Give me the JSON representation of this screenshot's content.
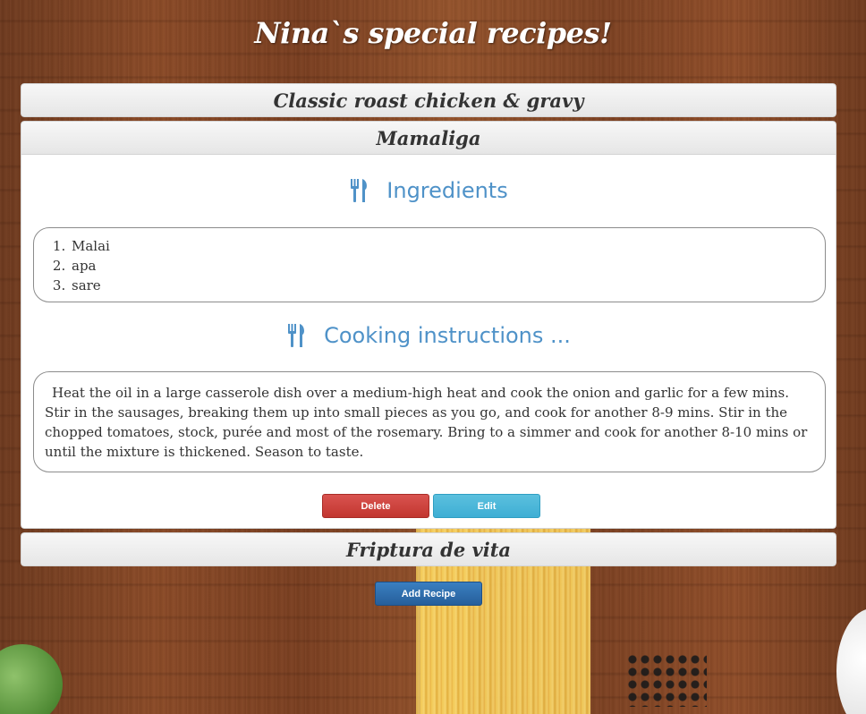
{
  "page": {
    "title": "Nina`s special recipes!"
  },
  "recipes": [
    {
      "title": "Classic roast chicken & gravy",
      "open": false
    },
    {
      "title": "Mamaliga",
      "open": true,
      "ingredients_heading": "Ingredients",
      "ingredients": [
        "Malai",
        "apa",
        "sare"
      ],
      "instructions_heading": "Cooking instructions ...",
      "instructions": "Heat the oil in a large casserole dish over a medium-high heat and cook the onion and garlic for a few mins. Stir in the sausages, breaking them up into small pieces as you go, and cook for another 8-9 mins. Stir in the chopped tomatoes, stock, purée and most of the rosemary. Bring to a simmer and cook for another 8-10 mins or until the mixture is thickened. Season to taste.",
      "delete_label": "Delete",
      "edit_label": "Edit"
    },
    {
      "title": "Friptura de vita",
      "open": false
    }
  ],
  "add_recipe_label": "Add Recipe",
  "icons": {
    "section_icon": "cutlery-icon"
  },
  "colors": {
    "heading_blue": "#4f92c8",
    "delete": "#d9534f",
    "edit": "#5bc0de",
    "add": "#2f6fae"
  }
}
